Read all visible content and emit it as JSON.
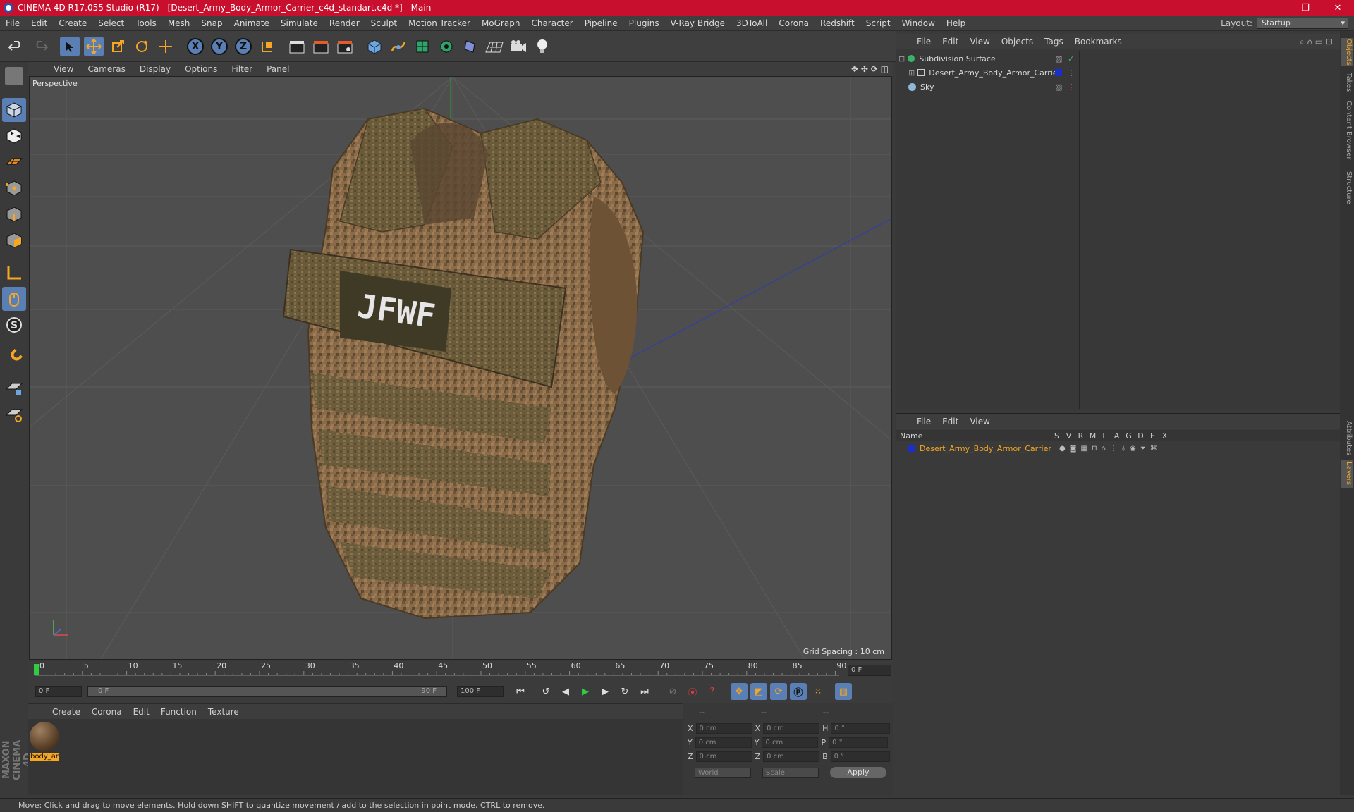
{
  "window": {
    "title": "CINEMA 4D R17.055 Studio (R17) - [Desert_Army_Body_Armor_Carrier_c4d_standart.c4d *] - Main",
    "controls": [
      "—",
      "❐",
      "✕"
    ]
  },
  "menubar": {
    "items": [
      "File",
      "Edit",
      "Create",
      "Select",
      "Tools",
      "Mesh",
      "Snap",
      "Animate",
      "Simulate",
      "Render",
      "Sculpt",
      "Motion Tracker",
      "MoGraph",
      "Character",
      "Pipeline",
      "Plugins",
      "V-Ray Bridge",
      "3DToAll",
      "Corona",
      "Redshift",
      "Script",
      "Window",
      "Help"
    ],
    "layout_label": "Layout:",
    "layout_value": "Startup"
  },
  "viewport": {
    "menu": [
      "View",
      "Cameras",
      "Display",
      "Options",
      "Filter",
      "Panel"
    ],
    "label": "Perspective",
    "grid_spacing": "Grid Spacing : 10 cm",
    "colors": {
      "background": "#4e4e4e",
      "grid": "#5d5d5d",
      "vest": "#8b6a48"
    }
  },
  "timeline": {
    "ticks": [
      "0",
      "5",
      "10",
      "15",
      "20",
      "25",
      "30",
      "35",
      "40",
      "45",
      "50",
      "55",
      "60",
      "65",
      "70",
      "75",
      "80",
      "85",
      "90"
    ],
    "current_frame": "0 F"
  },
  "anim": {
    "start": "0 F",
    "range_start": "0 F",
    "range_end": "90 F",
    "end": "100 F"
  },
  "material_manager": {
    "menu": [
      "Create",
      "Corona",
      "Edit",
      "Function",
      "Texture"
    ],
    "material_name": "body_ar"
  },
  "coordinates": {
    "headers": [
      "--",
      "--",
      "--"
    ],
    "rows": [
      {
        "a": "X",
        "av": "0 cm",
        "b": "X",
        "bv": "0 cm",
        "c": "H",
        "cv": "0 °"
      },
      {
        "a": "Y",
        "av": "0 cm",
        "b": "Y",
        "bv": "0 cm",
        "c": "P",
        "cv": "0 °"
      },
      {
        "a": "Z",
        "av": "0 cm",
        "b": "Z",
        "bv": "0 cm",
        "c": "B",
        "cv": "0 °"
      }
    ],
    "space": "World",
    "mode": "Scale",
    "apply": "Apply"
  },
  "object_manager": {
    "menu": [
      "File",
      "Edit",
      "View",
      "Objects",
      "Tags",
      "Bookmarks"
    ],
    "objects": [
      "Subdivision Surface",
      "Desert_Army_Body_Armor_Carrier",
      "Sky"
    ]
  },
  "layer_manager": {
    "menu": [
      "File",
      "Edit",
      "View"
    ],
    "columns": [
      "Name",
      "S",
      "V",
      "R",
      "M",
      "L",
      "A",
      "G",
      "D",
      "E",
      "X"
    ],
    "layer_name": "Desert_Army_Body_Armor_Carrier"
  },
  "right_tabs": [
    "Objects",
    "Takes",
    "Content Browser",
    "Structure",
    "Attributes",
    "Layers"
  ],
  "brand": "MAXON CINEMA 4D",
  "status": "Move: Click and drag to move elements. Hold down SHIFT to quantize movement / add to the selection in point mode, CTRL to remove."
}
